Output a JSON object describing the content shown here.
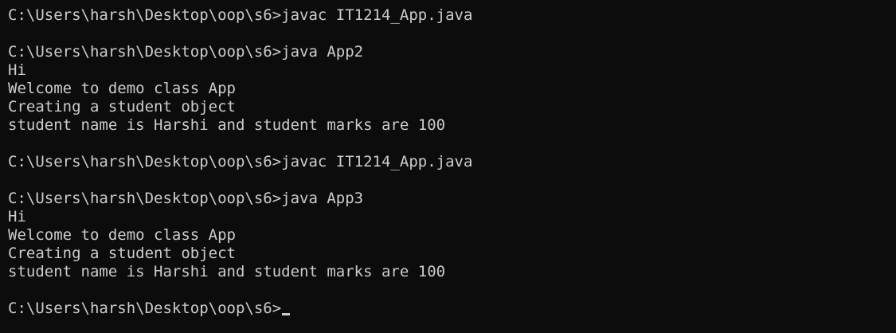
{
  "terminal": {
    "colors": {
      "background": "#0c0c0c",
      "foreground": "#cccccc"
    },
    "lines": [
      "C:\\Users\\harsh\\Desktop\\oop\\s6>javac IT1214_App.java",
      "",
      "C:\\Users\\harsh\\Desktop\\oop\\s6>java App2",
      "Hi",
      "Welcome to demo class App",
      "Creating a student object",
      "student name is Harshi and student marks are 100",
      "",
      "C:\\Users\\harsh\\Desktop\\oop\\s6>javac IT1214_App.java",
      "",
      "C:\\Users\\harsh\\Desktop\\oop\\s6>java App3",
      "Hi",
      "Welcome to demo class App",
      "Creating a student object",
      "student name is Harshi and student marks are 100",
      "",
      "C:\\Users\\harsh\\Desktop\\oop\\s6>"
    ]
  }
}
